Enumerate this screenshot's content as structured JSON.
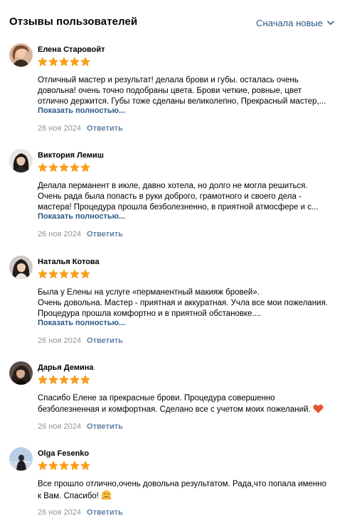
{
  "header": {
    "title": "Отзывы пользователей",
    "sort_label": "Сначала новые"
  },
  "reviews": [
    {
      "name": "Елена Старовойт",
      "rating": 5,
      "lines": [
        "Отличный мастер и результат! делала брови и губы. осталась очень",
        "довольна! очень точно подобраны цвета. Брови четкие, ровные, цвет",
        "отлично держится. Губы тоже сделаны великолепно, Прекрасный мастер,..."
      ],
      "show_more": "Показать полностью...",
      "date": "28 ноя 2024",
      "reply": "Ответить"
    },
    {
      "name": "Виктория Лемиш",
      "rating": 5,
      "lines": [
        "Делала перманент в июле, давно хотела, но долго не могла решиться.",
        "Очень рада была попасть в руки доброго, грамотного и своего дела -",
        "мастера! Процедура прошла безболезненно, в приятной атмосфере и с..."
      ],
      "show_more": "Показать полностью...",
      "date": "26 ноя 2024",
      "reply": "Ответить"
    },
    {
      "name": "Наталья Котова",
      "rating": 5,
      "lines": [
        "Была у Елены на услуге «перманентный макияж бровей».",
        "Очень довольна. Мастер - приятная и аккуратная. Учла все мои пожелания.",
        "Процедура прошла комфортно и в приятной обстановке...."
      ],
      "show_more": "Показать полностью...",
      "date": "26 ноя 2024",
      "reply": "Ответить"
    },
    {
      "name": "Дарья Демина",
      "rating": 5,
      "lines": [
        "Спасибо Елене за прекрасные брови. Процедура совершенно",
        "безболезненная и комфортная. Сделано все с учетом моих пожеланий."
      ],
      "emoji": "heart-emoji",
      "date": "26 ноя 2024",
      "reply": "Ответить"
    },
    {
      "name": "Olga Fesenko",
      "rating": 5,
      "lines": [
        "Все прошло отлично,очень довольна результатом. Рада,что попала именно",
        "к Вам. Спасибо!"
      ],
      "emoji": "hugging-face-emoji",
      "date": "26 ноя 2024",
      "reply": "Ответить"
    }
  ],
  "colors": {
    "accent": "#2a5885",
    "star": "#f8a01d",
    "muted": "#939393",
    "heart": "#e5562e"
  }
}
